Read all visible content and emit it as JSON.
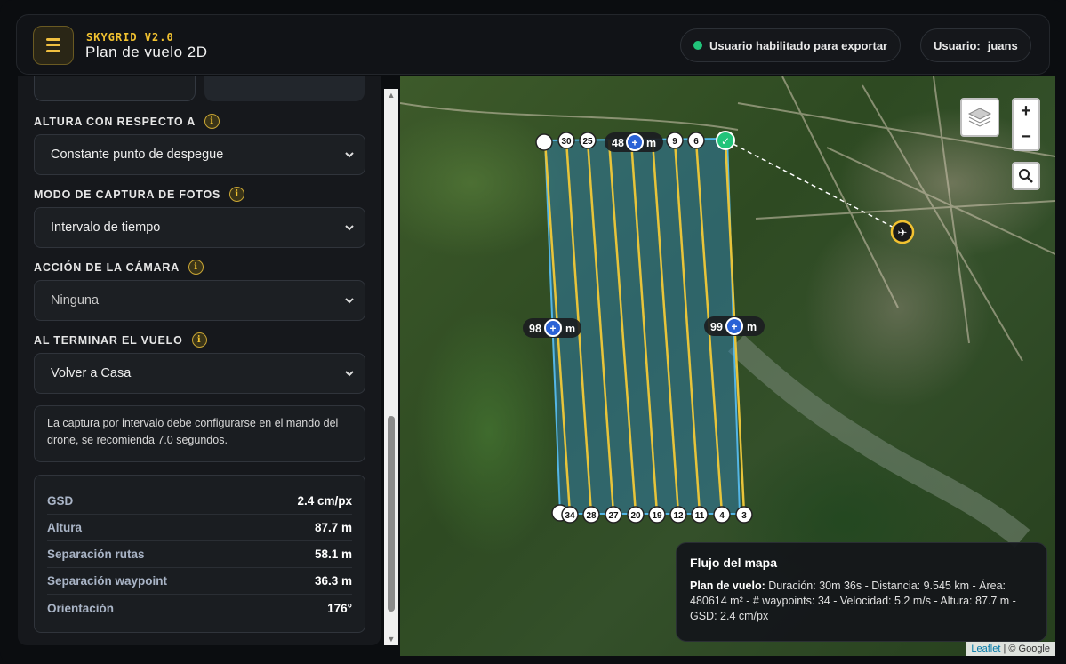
{
  "header": {
    "brand": "SKYGRID V2.0",
    "title": "Plan de vuelo 2D",
    "export_status": "Usuario habilitado para exportar",
    "user_label": "Usuario:",
    "user_name": "juans"
  },
  "panel": {
    "fields": [
      {
        "label": "ALTURA CON RESPECTO A",
        "value": "Constante punto de despegue"
      },
      {
        "label": "MODO DE CAPTURA DE FOTOS",
        "value": "Intervalo de tiempo"
      },
      {
        "label": "ACCIÓN DE LA CÁMARA",
        "value": "Ninguna"
      },
      {
        "label": "AL TERMINAR EL VUELO",
        "value": "Volver a Casa"
      }
    ],
    "note": "La captura por intervalo debe configurarse en el mando del drone, se recomienda 7.0 segundos.",
    "stats": [
      {
        "key": "GSD",
        "value": "2.4 cm/px"
      },
      {
        "key": "Altura",
        "value": "87.7 m"
      },
      {
        "key": "Separación rutas",
        "value": "58.1 m"
      },
      {
        "key": "Separación waypoint",
        "value": "36.3 m"
      },
      {
        "key": "Orientación",
        "value": "176°"
      }
    ]
  },
  "map": {
    "zoom_in": "+",
    "zoom_out": "−",
    "edge_labels": {
      "top": "48",
      "left": "98",
      "right": "99",
      "unit": "m"
    },
    "top_waypoints": [
      "30",
      "25",
      "9",
      "6"
    ],
    "bottom_waypoints": [
      "34",
      "28",
      "27",
      "20",
      "19",
      "12",
      "11",
      "4",
      "3"
    ],
    "attribution_leaflet": "Leaflet",
    "attribution_google": "| © Google"
  },
  "flow": {
    "title": "Flujo del mapa",
    "plan_label": "Plan de vuelo:",
    "plan_text": " Duración: 30m 36s - Distancia: 9.545 km - Área: 480614 m² - # waypoints: 34 - Velocidad: 5.2 m/s - Altura: 87.7 m - GSD: 2.4 cm/px"
  },
  "colors": {
    "accent": "#f2c230",
    "status_green": "#21c47a",
    "flight_line": "#e8c43a",
    "polygon_fill": "#2f7fb0",
    "marker_blue": "#2a62d6"
  }
}
